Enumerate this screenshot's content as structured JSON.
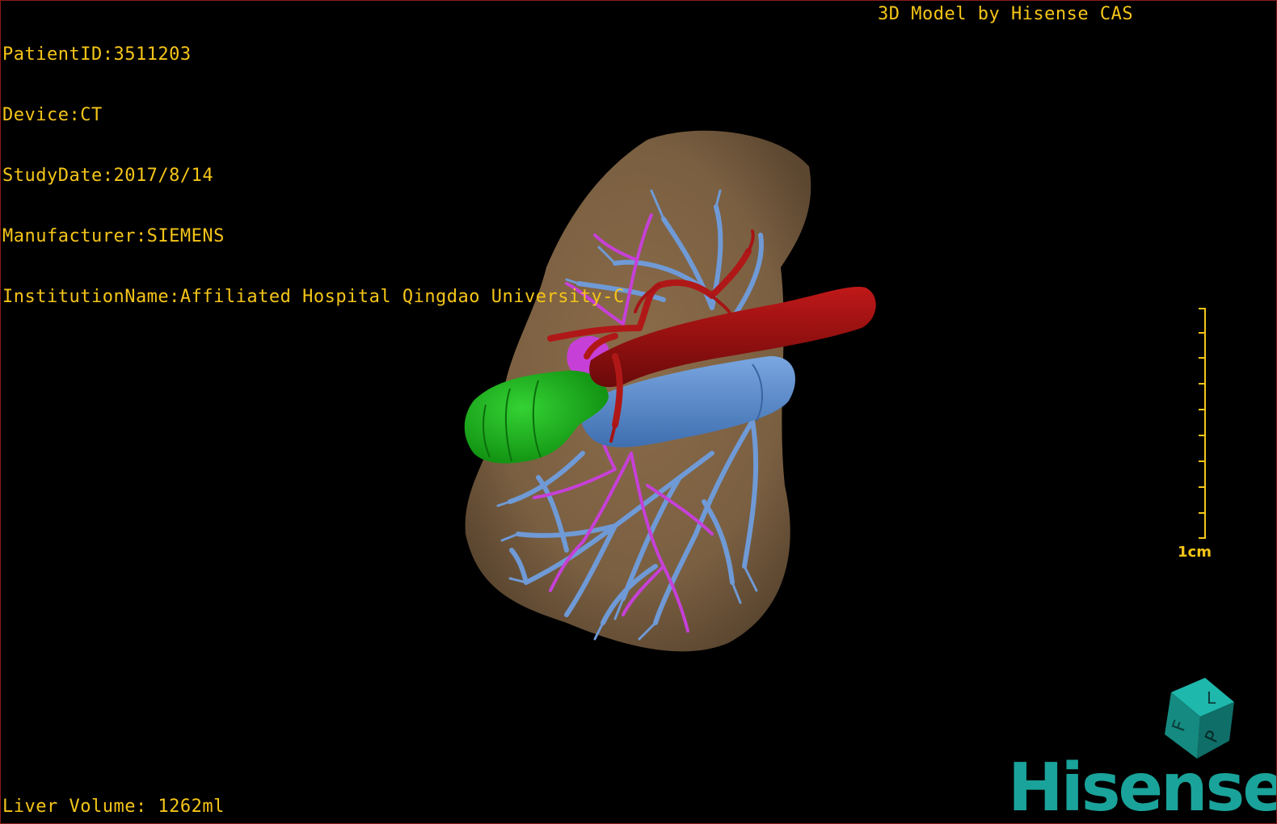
{
  "patient": {
    "id_line": "PatientID:3511203",
    "device_line": "Device:CT",
    "study_date_line": "StudyDate:2017/8/14",
    "manufacturer_line": "Manufacturer:SIEMENS",
    "institution_line": "InstitutionName:Affiliated Hospital Qingdao University-C"
  },
  "credit": "3D Model by Hisense CAS",
  "liver_volume": "Liver Volume: 1262ml",
  "scale": {
    "label": "1cm",
    "ticks": 10
  },
  "orientation_cube": {
    "faces": [
      "F",
      "L",
      "P"
    ]
  },
  "brand": "Hisense",
  "colors": {
    "overlay_text": "#f5c518",
    "liver": "#7a5f41",
    "hepatic_artery": "#a31515",
    "portal_vein": "#5f8fd0",
    "hepatic_vein": "#c33fd6",
    "bile_duct": "#1db21d",
    "brand": "#1aa39a"
  }
}
